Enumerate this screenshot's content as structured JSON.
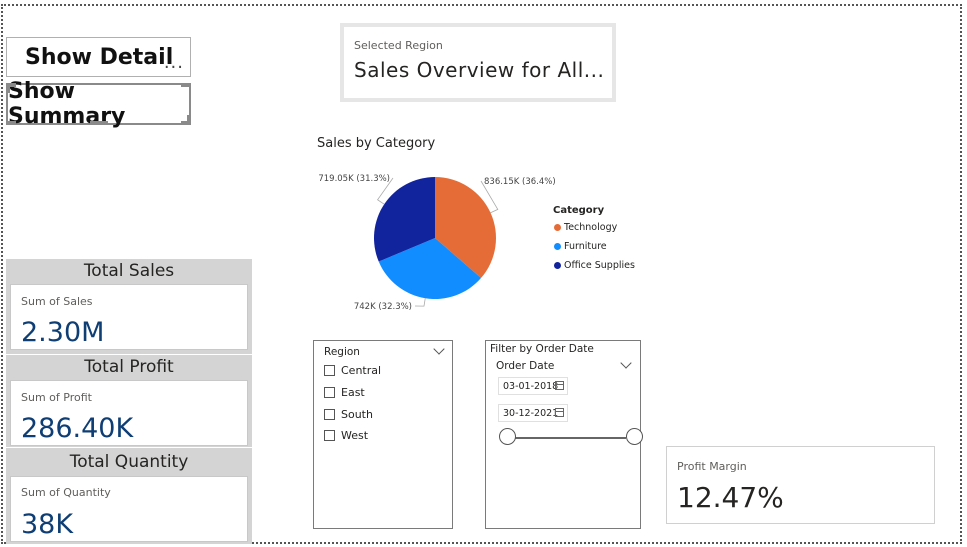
{
  "buttons": {
    "show_detail": "Show Detail",
    "show_summary": "Show Summary",
    "more": "..."
  },
  "selected_region": {
    "label": "Selected Region",
    "value": "Sales Overview for All..."
  },
  "chart_data": {
    "type": "pie",
    "title": "Sales by Category",
    "legend_title": "Category",
    "legend_position": "right",
    "categories": [
      "Technology",
      "Furniture",
      "Office Supplies"
    ],
    "values": [
      836.15,
      742,
      719.05
    ],
    "percents": [
      36.4,
      32.3,
      31.3
    ],
    "labels": [
      "836.15K (36.4%)",
      "742K (32.3%)",
      "719.05K (31.3%)"
    ],
    "colors": [
      "#E66C37",
      "#118DFF",
      "#12239E"
    ]
  },
  "kpis": [
    {
      "title": "Total Sales",
      "label": "Sum of Sales",
      "value": "2.30M"
    },
    {
      "title": "Total Profit",
      "label": "Sum of Profit",
      "value": "286.40K"
    },
    {
      "title": "Total Quantity",
      "label": "Sum of Quantity",
      "value": "38K"
    }
  ],
  "region_slicer": {
    "title": "Region",
    "options": [
      "Central",
      "East",
      "South",
      "West"
    ]
  },
  "date_slicer": {
    "title": "Filter by Order Date",
    "field": "Order Date",
    "start": "03-01-2018",
    "end": "30-12-2021",
    "range_fraction": [
      0,
      1
    ]
  },
  "profit_margin": {
    "label": "Profit Margin",
    "value": "12.47%"
  }
}
